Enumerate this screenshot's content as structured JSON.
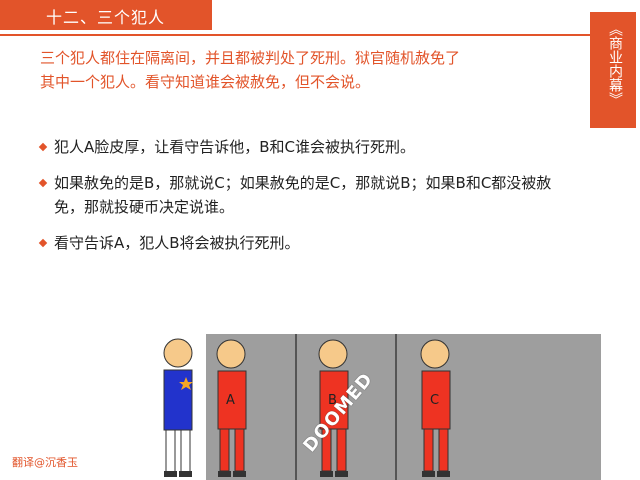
{
  "header": {
    "title": "十二、三个犯人"
  },
  "side_tab": {
    "label": "《商业内幕》"
  },
  "intro": {
    "line1": "三个犯人都住在隔离间，并且都被判处了死刑。狱官随机赦免了",
    "line2": "其中一个犯人。看守知道谁会被赦免，但不会说。"
  },
  "bullets": [
    {
      "text": "犯人A脸皮厚，让看守告诉他，B和C谁会被执行死刑。"
    },
    {
      "text": "如果赦免的是B，那就说C；如果赦免的是C，那就说B；如果B和C都没被赦免，那就投硬币决定说谁。"
    },
    {
      "text": "看守告诉A，犯人B将会被执行死刑。"
    }
  ],
  "illustration": {
    "prisoners": [
      {
        "label": "A"
      },
      {
        "label": "B"
      },
      {
        "label": "C"
      }
    ],
    "stamp_text": "DOOMED"
  },
  "footer": {
    "credit": "翻译@沉香玉"
  },
  "colors": {
    "accent": "#e2542a",
    "prisoner": "#ee3322",
    "guard": "#2233cc",
    "cell": "#9e9e9e"
  }
}
